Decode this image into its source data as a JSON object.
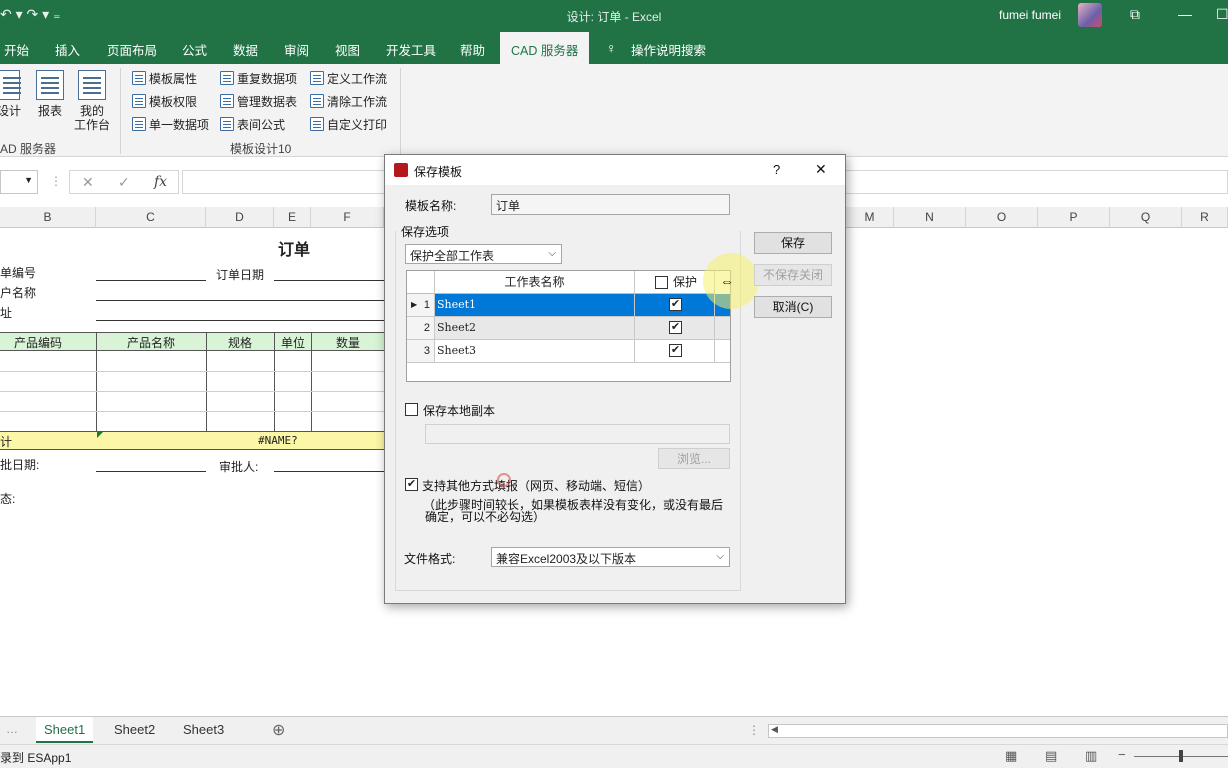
{
  "titlebar": {
    "qat": "↶ ▾  ↷ ▾  ₌",
    "title": "设计: 订单  -  Excel",
    "user": "fumei fumei",
    "win_restore": "⧉",
    "win_min": "—",
    "win_max": "☐"
  },
  "ribbon_tabs": [
    {
      "label": "开始"
    },
    {
      "label": "插入"
    },
    {
      "label": "页面布局"
    },
    {
      "label": "公式"
    },
    {
      "label": "数据"
    },
    {
      "label": "审阅"
    },
    {
      "label": "视图"
    },
    {
      "label": "开发工具"
    },
    {
      "label": "帮助"
    },
    {
      "label": "CAD 服务器"
    },
    {
      "label": "操作说明搜索"
    }
  ],
  "ribbon": {
    "big": {
      "design": "设计",
      "report": "报表",
      "workspace_1": "我的",
      "workspace_2": "工作台"
    },
    "group1_label": "AD 服务器",
    "small": [
      "模板属性",
      "模板权限",
      "单一数据项",
      "重复数据项",
      "管理数据表",
      "表间公式",
      "定义工作流",
      "清除工作流",
      "自定义打印"
    ],
    "group2_label": "模板设计10"
  },
  "formula_bar": {
    "cancel": "✕",
    "enter": "✓",
    "fx": "fx"
  },
  "columns": [
    "B",
    "C",
    "D",
    "E",
    "F",
    "M",
    "N",
    "O",
    "P",
    "Q",
    "R"
  ],
  "sheet": {
    "title": "订单",
    "order_no_label": "单编号",
    "order_date_label": "订单日期",
    "customer_label": "户名称",
    "address_label": "址",
    "headers": [
      "产品编码",
      "产品名称",
      "规格",
      "单位",
      "数量"
    ],
    "total_label": "计",
    "total_value": "#NAME?",
    "approve_date_label": "批日期:",
    "approver_label": "审批人:",
    "status_label": "态:"
  },
  "sheet_tabs": [
    "Sheet1",
    "Sheet2",
    "Sheet3"
  ],
  "add_sheet": "⊕",
  "status_bar": {
    "text": "录到 ESApp1"
  },
  "dialog": {
    "title": "保存模板",
    "help": "?",
    "close": "✕",
    "template_name_label": "模板名称:",
    "template_name_value": "订单",
    "save_options_label": "保存选项",
    "protect_select": "保护全部工作表",
    "grid_headers": {
      "name": "工作表名称",
      "protect": "保护"
    },
    "rows": [
      {
        "num": "1",
        "name": "Sheet1",
        "protect": true
      },
      {
        "num": "2",
        "name": "Sheet2",
        "protect": true
      },
      {
        "num": "3",
        "name": "Sheet3",
        "protect": true
      }
    ],
    "buttons": {
      "save": "保存",
      "close_no_save": "不保存关闭",
      "cancel": "取消(C)"
    },
    "local_copy_label": "保存本地副本",
    "browse": "浏览...",
    "other_fill_label": "支持其他方式填报（网页、移动端、短信）",
    "other_fill_note_1": "（此步骤时间较长，如果模板表样没有变化，或没有最后",
    "other_fill_note_2": "确定，可以不必勾选）",
    "file_format_label": "文件格式:",
    "file_format_value": "兼容Excel2003及以下版本"
  },
  "colors": {
    "excel_green": "#217346",
    "select_blue": "#0078d7"
  }
}
